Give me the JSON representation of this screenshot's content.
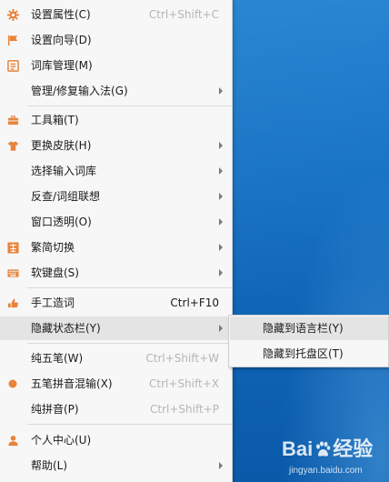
{
  "menu": {
    "items": [
      {
        "label": "设置属性(C)",
        "shortcut": "Ctrl+Shift+C",
        "icon": "gear-icon"
      },
      {
        "label": "设置向导(D)",
        "icon": "flag-icon"
      },
      {
        "label": "词库管理(M)",
        "icon": "dictionary-icon"
      },
      {
        "label": "管理/修复输入法(G)",
        "has_submenu": true
      },
      {
        "label": "工具箱(T)",
        "icon": "toolbox-icon"
      },
      {
        "label": "更换皮肤(H)",
        "icon": "shirt-icon",
        "has_submenu": true
      },
      {
        "label": "选择输入词库",
        "has_submenu": true
      },
      {
        "label": "反查/词组联想",
        "has_submenu": true
      },
      {
        "label": "窗口透明(O)",
        "has_submenu": true
      },
      {
        "label": "繁简切换",
        "icon": "traditional-simplified-icon",
        "has_submenu": true
      },
      {
        "label": "软键盘(S)",
        "icon": "keyboard-icon",
        "has_submenu": true
      },
      {
        "label": "手工造词",
        "shortcut": "Ctrl+F10",
        "icon": "hand-icon"
      },
      {
        "label": "隐藏状态栏(Y)",
        "has_submenu": true,
        "active": true
      },
      {
        "label": "纯五笔(W)",
        "shortcut": "Ctrl+Shift+W"
      },
      {
        "label": "五笔拼音混输(X)",
        "shortcut": "Ctrl+Shift+X",
        "icon": "selected-dot-icon"
      },
      {
        "label": "纯拼音(P)",
        "shortcut": "Ctrl+Shift+P"
      },
      {
        "label": "个人中心(U)",
        "icon": "user-icon"
      },
      {
        "label": "帮助(L)",
        "has_submenu": true
      }
    ]
  },
  "submenu": {
    "items": [
      {
        "label": "隐藏到语言栏(Y)",
        "active": true
      },
      {
        "label": "隐藏到托盘区(T)"
      }
    ]
  },
  "watermark": {
    "logo_left": "Bai",
    "logo_right": "经验",
    "url": "jingyan.baidu.com"
  },
  "colors": {
    "icon_orange": "#e8833a",
    "menu_bg": "#f7f7f7",
    "highlight_bg": "#e4e4e4",
    "desktop_blue": "#1570c2"
  }
}
